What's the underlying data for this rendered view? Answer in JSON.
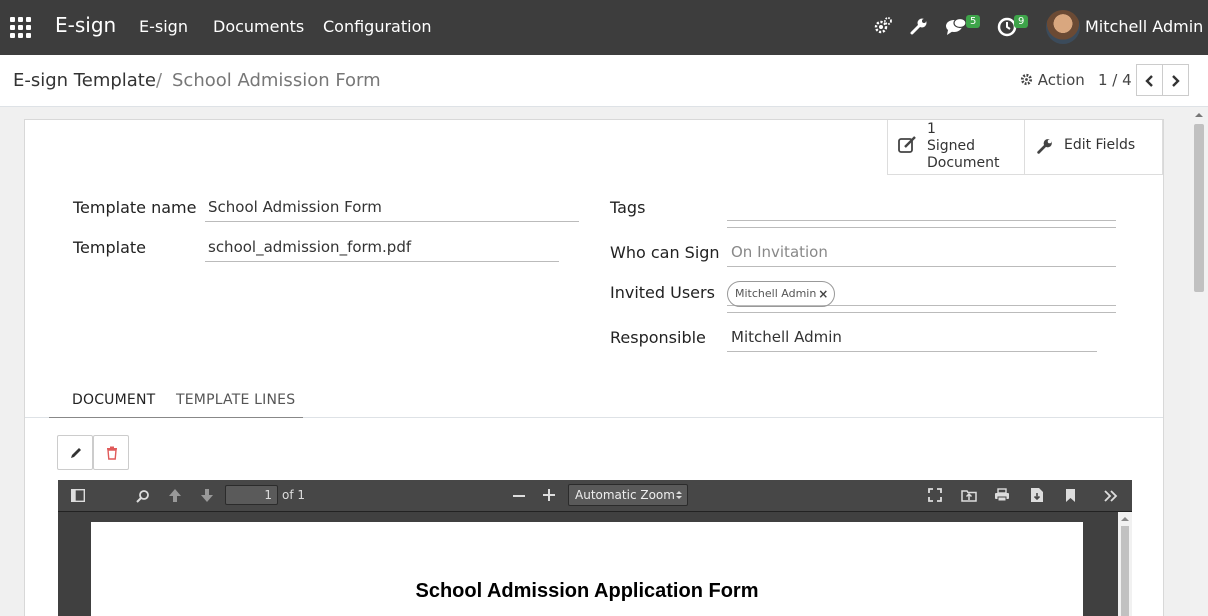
{
  "topnav": {
    "app_name": "E-sign",
    "menus": [
      "E-sign",
      "Documents",
      "Configuration"
    ],
    "messages_count": "5",
    "activities_count": "9",
    "user_name": "Mitchell Admin"
  },
  "breadcrumb": {
    "parent": "E-sign Template",
    "separator": "/",
    "current": "School Admission Form"
  },
  "controls": {
    "action_label": "Action",
    "pager": "1 / 4"
  },
  "stats": {
    "signed_count": "1",
    "signed_label_1": "Signed",
    "signed_label_2": "Document",
    "edit_fields": "Edit Fields"
  },
  "form": {
    "template_name_label": "Template name",
    "template_name": "School Admission Form",
    "template_label": "Template",
    "template_file": "school_admission_form.pdf",
    "tags_label": "Tags",
    "who_can_sign_label": "Who can Sign",
    "who_can_sign": "On Invitation",
    "invited_users_label": "Invited Users",
    "invited_user_tag": "Mitchell Admin",
    "responsible_label": "Responsible",
    "responsible": "Mitchell Admin"
  },
  "tabs": [
    "DOCUMENT",
    "TEMPLATE LINES"
  ],
  "pdf": {
    "page_number": "1",
    "page_total": "of 1",
    "zoom": "Automatic Zoom",
    "document_title": "School Admission Application Form"
  },
  "colors": {
    "navbar": "#3d3d3d",
    "badge": "#3ea44a",
    "delete_red": "#e05a5a"
  }
}
